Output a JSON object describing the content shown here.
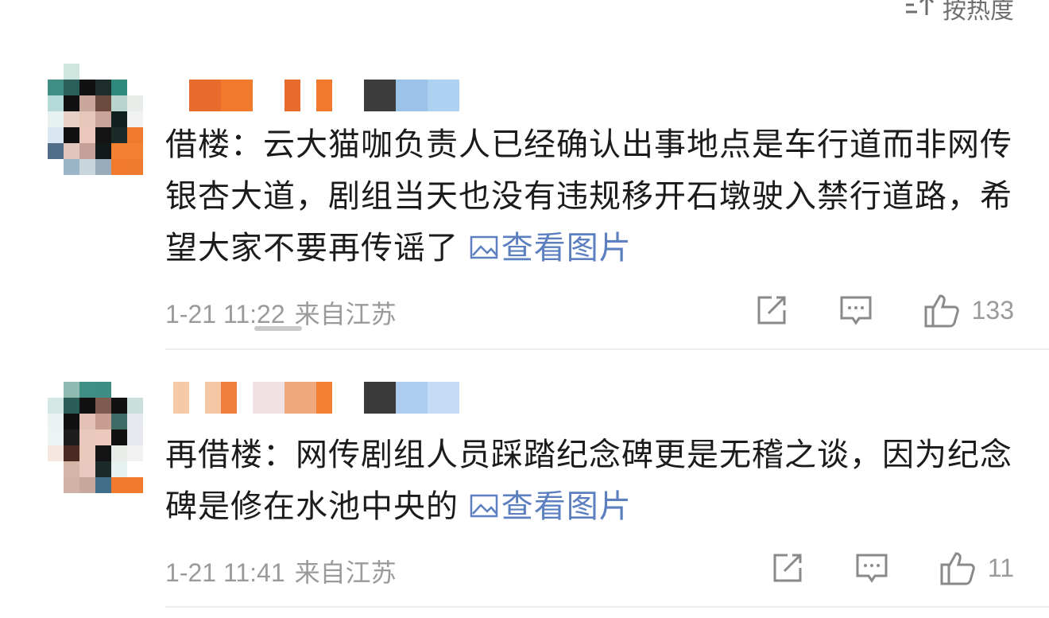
{
  "sort": {
    "label": "按热度"
  },
  "comments": [
    {
      "text": "借楼：云大猫咖负责人已经确认出事地点是车行道而非网传银杏大道，剧组当天也没有违规移开石墩驶入禁行道路，希望大家不要再传谣了",
      "image_link": "查看图片",
      "time": "1-21 11:22",
      "location": "来自江苏",
      "likes": "133"
    },
    {
      "text": "再借楼：网传剧组人员踩踏纪念碑更是无稽之谈，因为纪念碑是修在水池中央的",
      "image_link": "查看图片",
      "time": "1-21 11:41",
      "location": "来自江苏",
      "likes": "11"
    }
  ],
  "icons": {
    "sort": "sort-icon",
    "image": "image-icon",
    "share": "share-icon",
    "reply": "reply-icon",
    "like": "thumbs-up-icon"
  },
  "colors": {
    "link": "#5b7fbf",
    "meta": "#9a9a9a",
    "text": "#1b1b1b"
  }
}
